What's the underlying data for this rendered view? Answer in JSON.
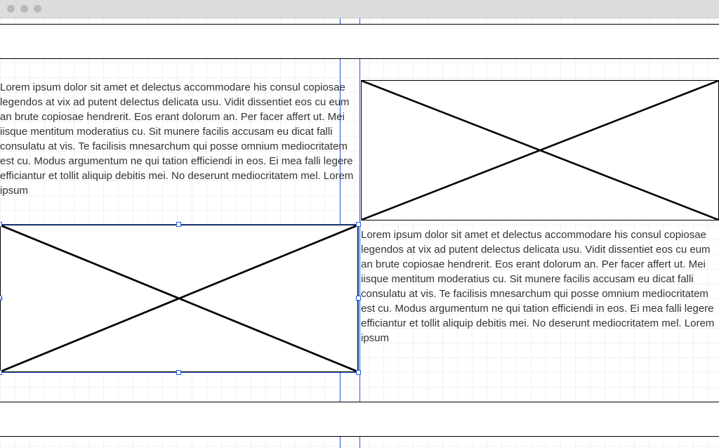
{
  "titlebar": {
    "dots": [
      "close",
      "minimize",
      "zoom"
    ]
  },
  "content": {
    "lorem": "Lorem ipsum dolor sit amet et delectus accommodare his consul copiosae legendos at vix ad putent delectus delicata usu. Vidit dissentiet eos cu eum an brute copiosae hendrerit. Eos erant dolorum an. Per facer affert ut. Mei iisque mentitum moderatius cu. Sit munere facilis accusam eu dicat falli consulatu at vis. Te facilisis mnesarchum qui posse omnium mediocritatem est cu. Modus argumentum ne qui tation efficiendi in eos. Ei mea falli legere efficiantur et tollit aliquip debitis mei. No deserunt mediocritatem mel. Lorem ipsum"
  },
  "selection": {
    "element": "image-placeholder-left",
    "guides_x": [
      484,
      512
    ]
  }
}
